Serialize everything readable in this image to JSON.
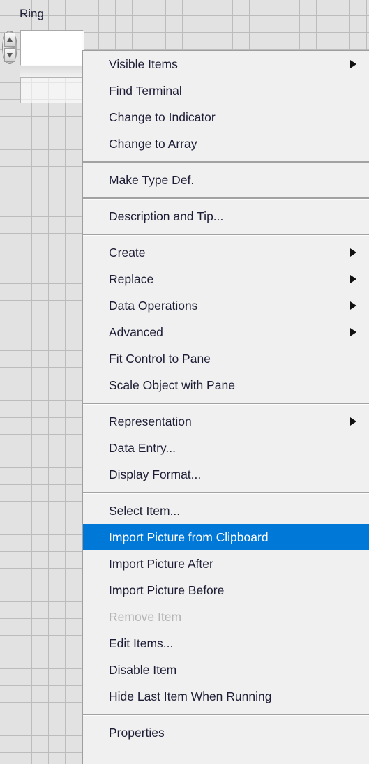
{
  "panel": {
    "grid_cell_color": "#e2e2e2",
    "grid_line_color": "#bcbcbc"
  },
  "ring_control": {
    "label": "Ring",
    "value": "",
    "spinner": {
      "increment_icon": "triangle-up-icon",
      "decrement_icon": "triangle-down-icon"
    }
  },
  "context_menu": {
    "highlight_color": "#0078d7",
    "background_color": "#f0f0f0",
    "text_color": "#1d1d35",
    "disabled_text_color": "#b3b3b3",
    "submenu_icon": "triangle-right-icon",
    "groups": [
      {
        "items": [
          {
            "label": "Visible Items",
            "submenu": true,
            "state": "normal"
          },
          {
            "label": "Find Terminal",
            "submenu": false,
            "state": "normal"
          },
          {
            "label": "Change to Indicator",
            "submenu": false,
            "state": "normal"
          },
          {
            "label": "Change to Array",
            "submenu": false,
            "state": "normal"
          }
        ]
      },
      {
        "items": [
          {
            "label": "Make Type Def.",
            "submenu": false,
            "state": "normal"
          }
        ]
      },
      {
        "items": [
          {
            "label": "Description and Tip...",
            "submenu": false,
            "state": "normal"
          }
        ]
      },
      {
        "items": [
          {
            "label": "Create",
            "submenu": true,
            "state": "normal"
          },
          {
            "label": "Replace",
            "submenu": true,
            "state": "normal"
          },
          {
            "label": "Data Operations",
            "submenu": true,
            "state": "normal"
          },
          {
            "label": "Advanced",
            "submenu": true,
            "state": "normal"
          },
          {
            "label": "Fit Control to Pane",
            "submenu": false,
            "state": "normal"
          },
          {
            "label": "Scale Object with Pane",
            "submenu": false,
            "state": "normal"
          }
        ]
      },
      {
        "items": [
          {
            "label": "Representation",
            "submenu": true,
            "state": "normal"
          },
          {
            "label": "Data Entry...",
            "submenu": false,
            "state": "normal"
          },
          {
            "label": "Display Format...",
            "submenu": false,
            "state": "normal"
          }
        ]
      },
      {
        "items": [
          {
            "label": "Select Item...",
            "submenu": false,
            "state": "normal"
          },
          {
            "label": "Import Picture from Clipboard",
            "submenu": false,
            "state": "highlighted"
          },
          {
            "label": "Import Picture After",
            "submenu": false,
            "state": "normal"
          },
          {
            "label": "Import Picture Before",
            "submenu": false,
            "state": "normal"
          },
          {
            "label": "Remove Item",
            "submenu": false,
            "state": "disabled"
          },
          {
            "label": "Edit Items...",
            "submenu": false,
            "state": "normal"
          },
          {
            "label": "Disable Item",
            "submenu": false,
            "state": "normal"
          },
          {
            "label": "Hide Last Item When Running",
            "submenu": false,
            "state": "normal"
          }
        ]
      },
      {
        "items": [
          {
            "label": "Properties",
            "submenu": false,
            "state": "normal"
          }
        ]
      }
    ]
  }
}
